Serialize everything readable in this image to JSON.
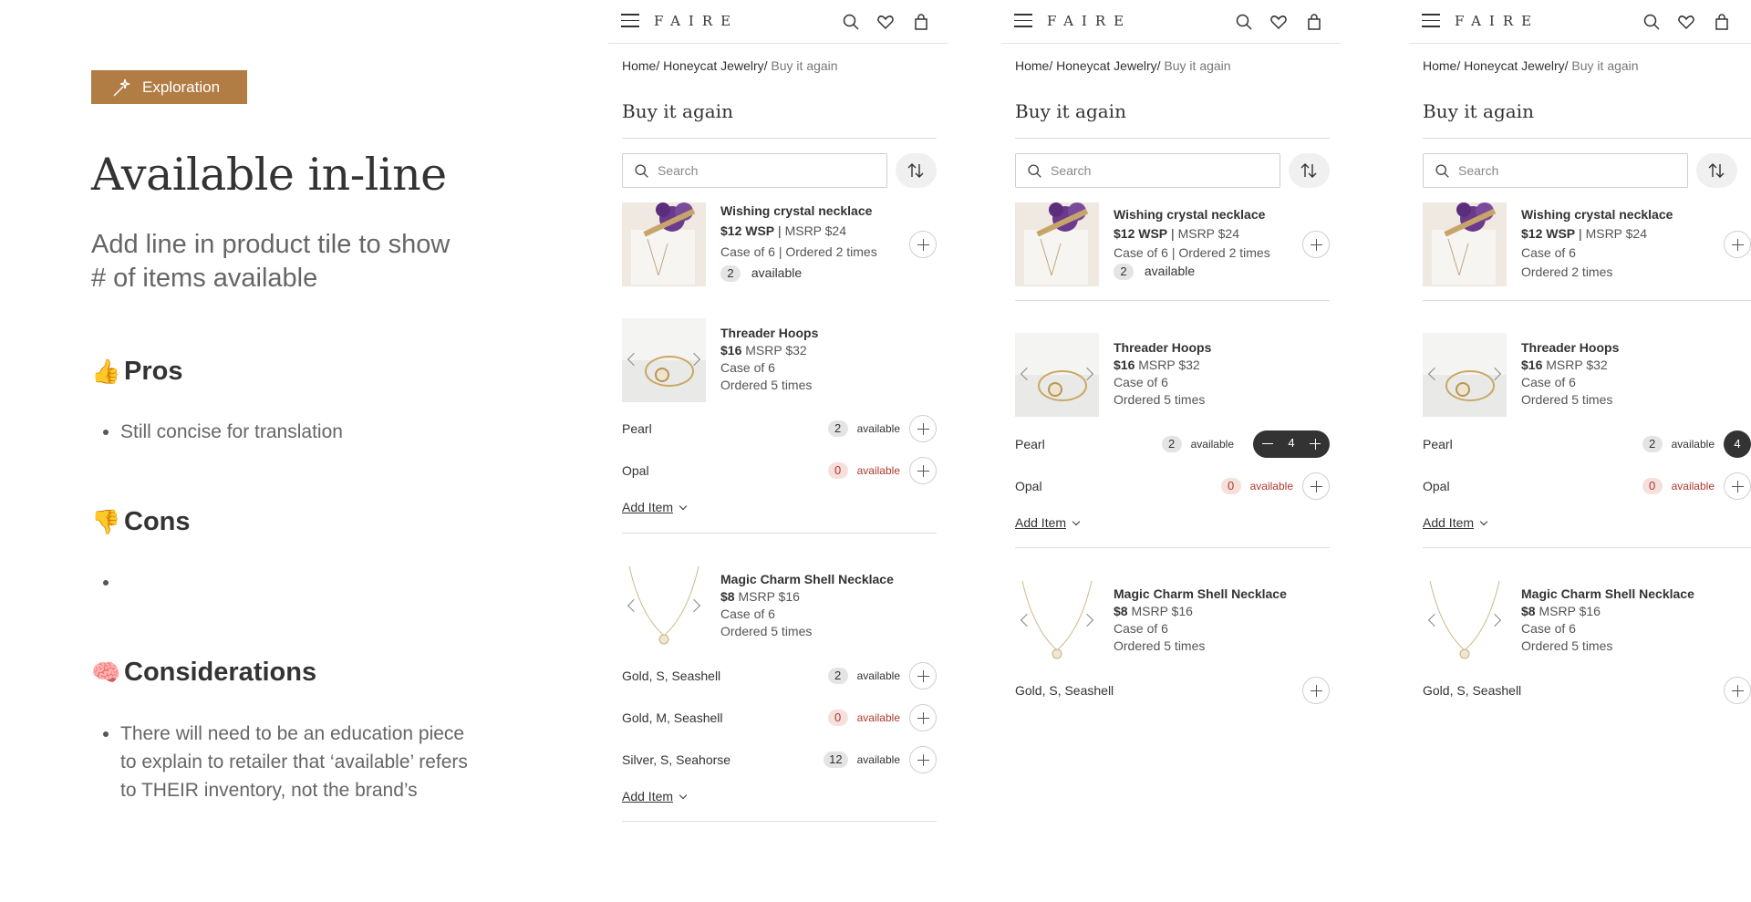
{
  "left": {
    "tag_label": "Exploration",
    "title": "Available in-line",
    "subtitle": "Add line in product tile to show # of items available",
    "pros": {
      "emoji": "👍",
      "title": "Pros",
      "items": [
        "Still concise for translation"
      ]
    },
    "cons": {
      "emoji": "👎",
      "title": "Cons",
      "items": [
        ""
      ]
    },
    "considerations": {
      "emoji": "🧠",
      "title": "Considerations",
      "items": [
        "There will need to be an education piece to explain to retailer that ‘available’ refers to THEIR inventory, not the brand’s"
      ]
    }
  },
  "colors": {
    "accent": "#b17d45",
    "zero_text": "#b0392c",
    "dark": "#333333"
  },
  "phone": {
    "logo": "FAIRE",
    "breadcrumb": {
      "home": "Home",
      "sep": "/",
      "brand": "Honeycat Jewelry",
      "current": "Buy it again"
    },
    "page_title": "Buy it again",
    "search_placeholder": "Search",
    "available_label": "available",
    "add_item_label": "Add Item"
  },
  "screens": [
    {
      "products": {
        "p1": {
          "name": "Wishing crystal necklace",
          "wsp": "$12 WSP",
          "msrp": "MSRP $24",
          "case": "Case of 6 | Ordered 2 times",
          "available": "2"
        },
        "p2": {
          "name": "Threader Hoops",
          "price": "$16",
          "msrp": "MSRP $32",
          "case": "Case of 6",
          "ordered": "Ordered 5 times",
          "variants": [
            {
              "name": "Pearl",
              "available": "2"
            },
            {
              "name": "Opal",
              "available": "0"
            }
          ]
        },
        "p3": {
          "name": "Magic Charm Shell Necklace",
          "price": "$8",
          "msrp": "MSRP $16",
          "case": "Case of 6",
          "ordered": "Ordered 5 times",
          "variants": [
            {
              "name": "Gold, S, Seashell",
              "available": "2"
            },
            {
              "name": "Gold, M, Seashell",
              "available": "0"
            },
            {
              "name": "Silver, S, Seahorse",
              "available": "12"
            }
          ]
        }
      }
    },
    {
      "products": {
        "p1": {
          "name": "Wishing crystal necklace",
          "wsp": "$12 WSP",
          "msrp": "MSRP $24",
          "case": "Case of 6 | Ordered 2 times",
          "available": "2"
        },
        "p2": {
          "name": "Threader Hoops",
          "price": "$16",
          "msrp": "MSRP $32",
          "case": "Case of 6",
          "ordered": "Ordered 5 times",
          "variants": [
            {
              "name": "Pearl",
              "available": "2",
              "quantity": "4"
            },
            {
              "name": "Opal",
              "available": "0"
            }
          ]
        },
        "p3": {
          "name": "Magic Charm Shell Necklace",
          "price": "$8",
          "msrp": "MSRP $16",
          "case": "Case of 6",
          "ordered": "Ordered 5 times",
          "variants": [
            {
              "name": "Gold, S, Seashell"
            }
          ]
        }
      }
    },
    {
      "products": {
        "p1": {
          "name": "Wishing crystal necklace",
          "wsp": "$12 WSP",
          "msrp": "MSRP $24",
          "case": "Case of 6",
          "ordered": "Ordered 2 times"
        },
        "p2": {
          "name": "Threader Hoops",
          "price": "$16",
          "msrp": "MSRP $32",
          "case": "Case of 6",
          "ordered": "Ordered 5 times",
          "variants": [
            {
              "name": "Pearl",
              "available": "2",
              "quantity": "4"
            },
            {
              "name": "Opal",
              "available": "0"
            }
          ]
        },
        "p3": {
          "name": "Magic Charm Shell Necklace",
          "price": "$8",
          "msrp": "MSRP $16",
          "case": "Case of 6",
          "ordered": "Ordered 5 times",
          "variants": [
            {
              "name": "Gold, S, Seashell"
            }
          ]
        }
      }
    }
  ]
}
